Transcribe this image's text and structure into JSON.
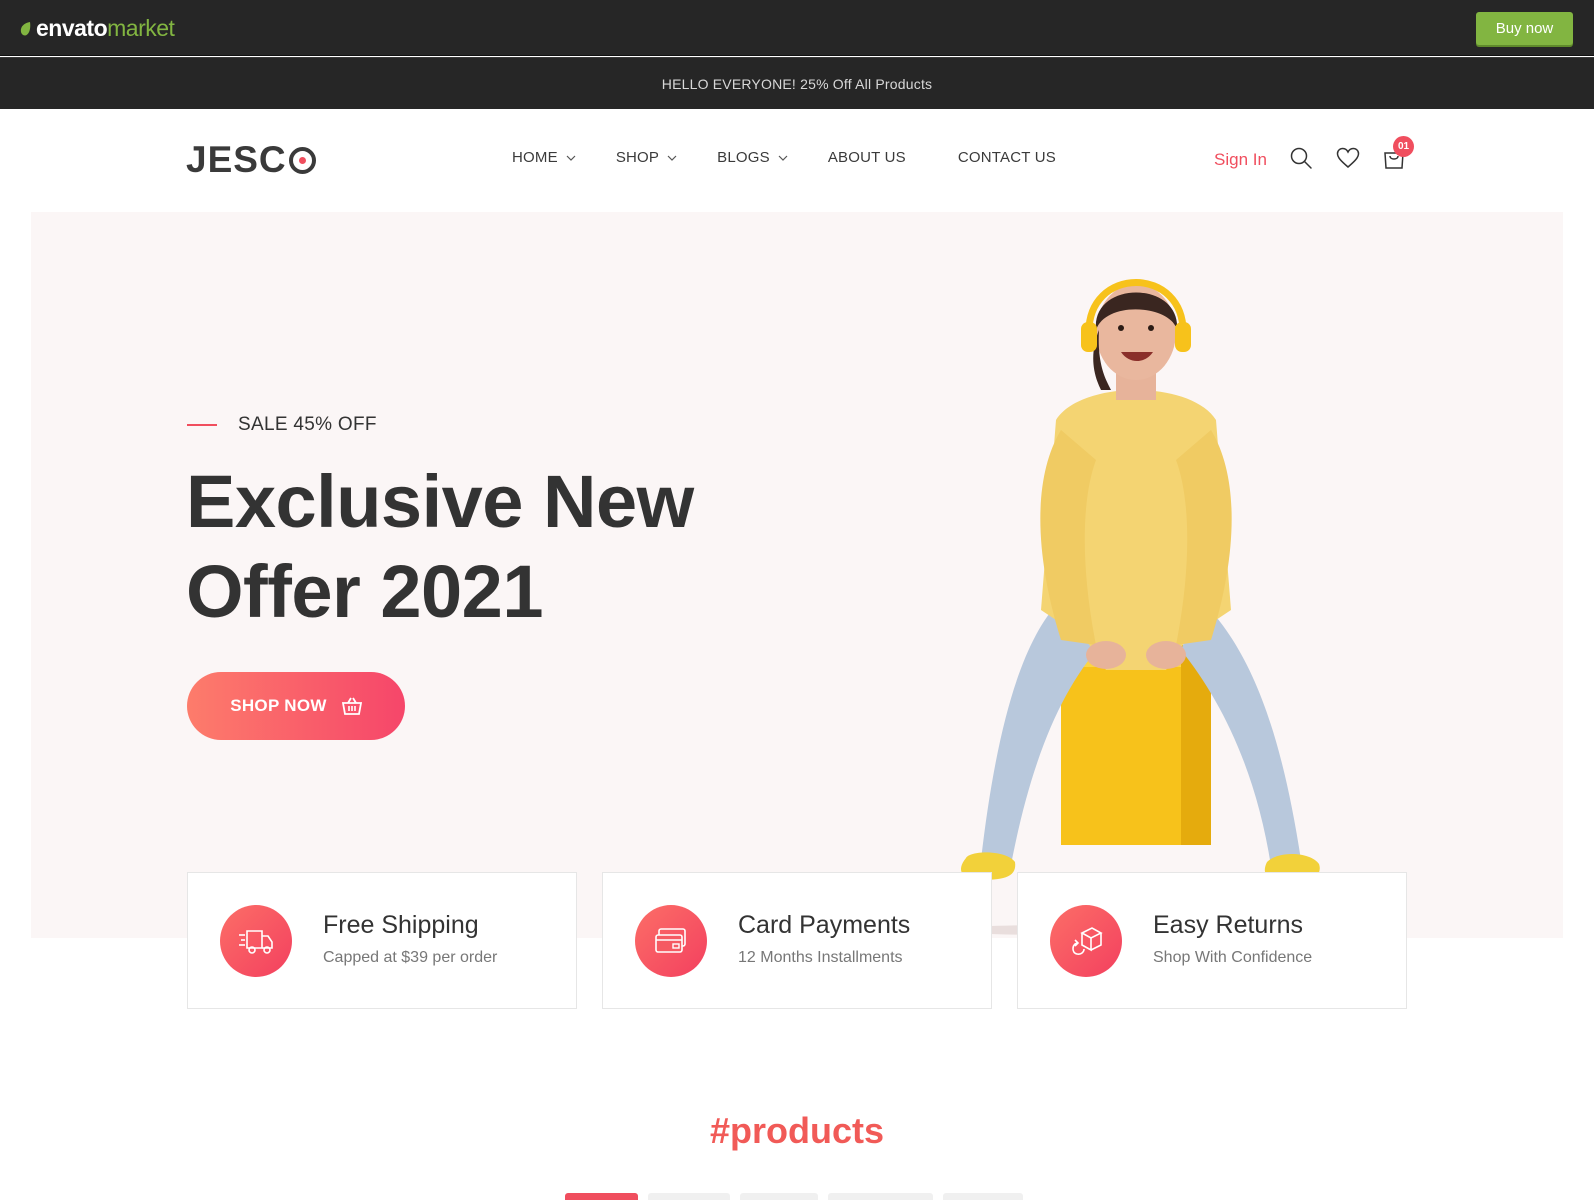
{
  "envato": {
    "brand": "envato",
    "market": "market",
    "buy_now": "Buy now",
    "accent": "#82b541"
  },
  "announcement": "HELLO EVERYONE! 25% Off All Products",
  "header": {
    "logo": "JESC",
    "nav": [
      {
        "label": "HOME",
        "dropdown": true
      },
      {
        "label": "SHOP",
        "dropdown": true
      },
      {
        "label": "BLOGS",
        "dropdown": true
      },
      {
        "label": "ABOUT US",
        "dropdown": false
      },
      {
        "label": "CONTACT US",
        "dropdown": false
      }
    ],
    "sign_in": "Sign In",
    "cart_count": "01",
    "accent": "#f04e5e"
  },
  "hero": {
    "eyebrow": "SALE 45% OFF",
    "title_line1": "Exclusive New",
    "title_line2": "Offer 2021",
    "cta": "SHOP NOW"
  },
  "features": [
    {
      "icon": "delivery-truck-icon",
      "title": "Free Shipping",
      "subtitle": "Capped at $39 per order"
    },
    {
      "icon": "credit-card-icon",
      "title": "Card Payments",
      "subtitle": "12 Months Installments"
    },
    {
      "icon": "return-box-icon",
      "title": "Easy Returns",
      "subtitle": "Shop With Confidence"
    }
  ],
  "products": {
    "heading": "#products"
  }
}
